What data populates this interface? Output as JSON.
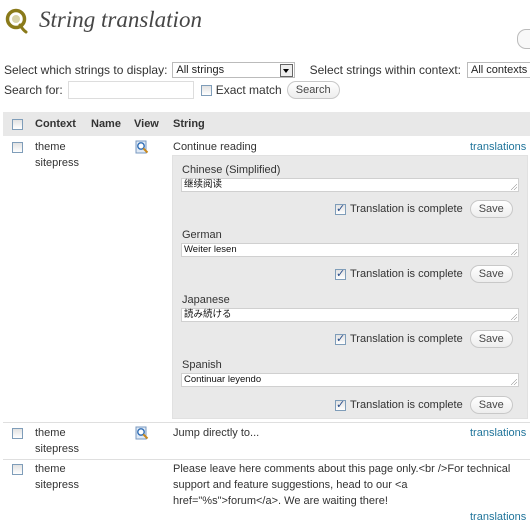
{
  "page": {
    "title": "String translation"
  },
  "filters": {
    "display_label": "Select which strings to display:",
    "display_value": "All strings",
    "context_label": "Select strings within context:",
    "context_value": "All contexts"
  },
  "search": {
    "label": "Search for:",
    "value": "",
    "exact_match_label": "Exact match",
    "button_label": "Search"
  },
  "table": {
    "headers": [
      "Context",
      "Name",
      "View",
      "String"
    ],
    "rows": [
      {
        "context_line1": "theme",
        "context_line2": "sitepress",
        "string": "Continue reading",
        "translations_link": "translations"
      },
      {
        "context_line1": "theme",
        "context_line2": "sitepress",
        "string": "Jump directly to...",
        "translations_link": "translations"
      },
      {
        "context_line1": "theme",
        "context_line2": "sitepress",
        "string_lines": [
          "Please leave here comments about this page only.<br />For technical",
          "support and feature suggestions, head to our <a",
          "href=\"%s\">forum</a>. We are waiting there!"
        ],
        "translations_link": "translations"
      }
    ]
  },
  "translations": {
    "complete_label": "Translation is complete",
    "save_label": "Save",
    "items": [
      {
        "language": "Chinese (Simplified)",
        "value": "继续阅读",
        "complete": true
      },
      {
        "language": "German",
        "value": "Weiter lesen",
        "complete": true
      },
      {
        "language": "Japanese",
        "value": "読み続ける",
        "complete": true
      },
      {
        "language": "Spanish",
        "value": "Continuar leyendo",
        "complete": true
      }
    ]
  },
  "colors": {
    "header_bg": "#e8e8e8",
    "panel_bg": "#e9e9e9",
    "link": "#21759b",
    "title": "#464646",
    "logo": "#8a7a1a"
  }
}
